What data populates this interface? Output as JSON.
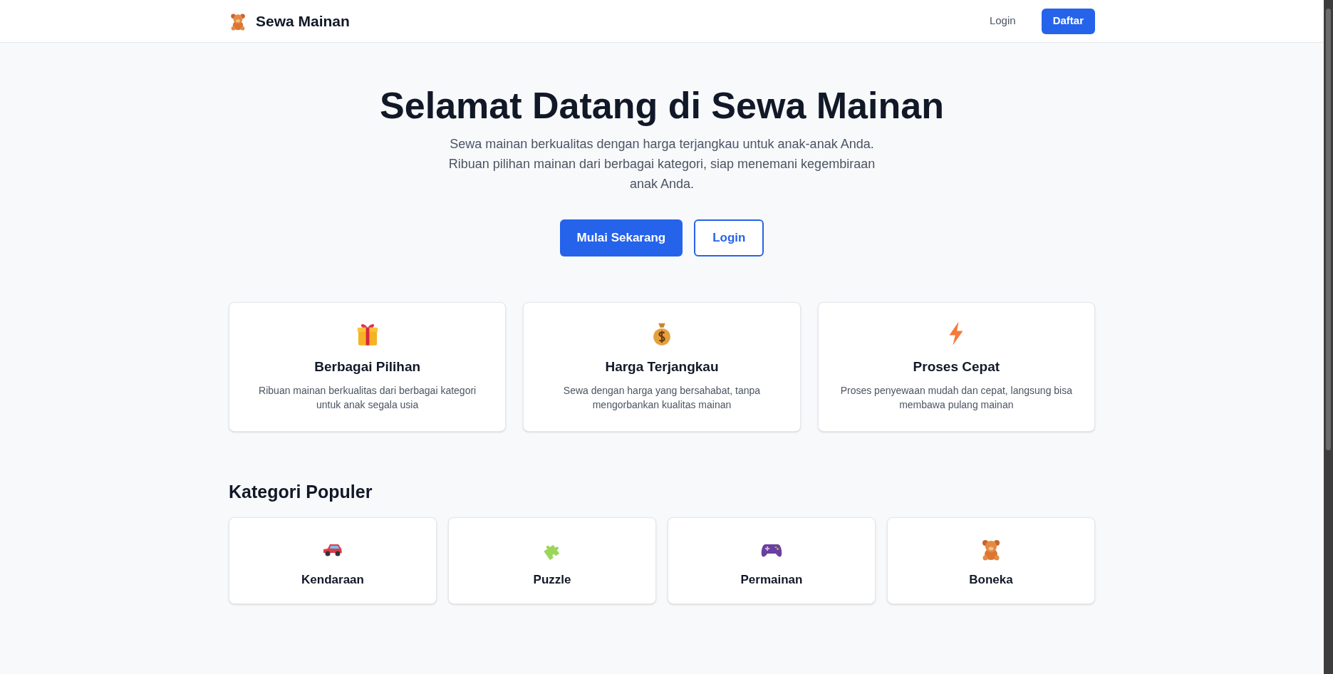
{
  "header": {
    "brand": "Sewa Mainan",
    "links": [
      {
        "label": "Login",
        "kind": "link"
      },
      {
        "label": "Daftar",
        "kind": "primary"
      }
    ]
  },
  "hero": {
    "title": "Selamat Datang di Sewa Mainan",
    "subtitle": "Sewa mainan berkualitas dengan harga terjangkau untuk anak-anak Anda. Ribuan pilihan mainan dari berbagai kategori, siap menemani kegembiraan anak Anda.",
    "buttons": [
      {
        "label": "Mulai Sekarang",
        "kind": "primary"
      },
      {
        "label": "Login",
        "kind": "outline"
      }
    ]
  },
  "features": [
    {
      "kind": "gift",
      "title": "Berbagai Pilihan",
      "text": "Ribuan mainan berkualitas dari berbagai kategori untuk anak segala usia"
    },
    {
      "kind": "money",
      "title": "Harga Terjangkau",
      "text": "Sewa dengan harga yang bersahabat, tanpa mengorbankan kualitas mainan"
    },
    {
      "kind": "bolt",
      "title": "Proses Cepat",
      "text": "Proses penyewaan mudah dan cepat, langsung bisa membawa pulang mainan"
    }
  ],
  "categories": {
    "heading": "Kategori Populer",
    "items": [
      {
        "kind": "car",
        "label": "Kendaraan"
      },
      {
        "kind": "puzzle",
        "label": "Puzzle"
      },
      {
        "kind": "gamepad",
        "label": "Permainan"
      },
      {
        "kind": "bear",
        "label": "Boneka"
      }
    ]
  }
}
